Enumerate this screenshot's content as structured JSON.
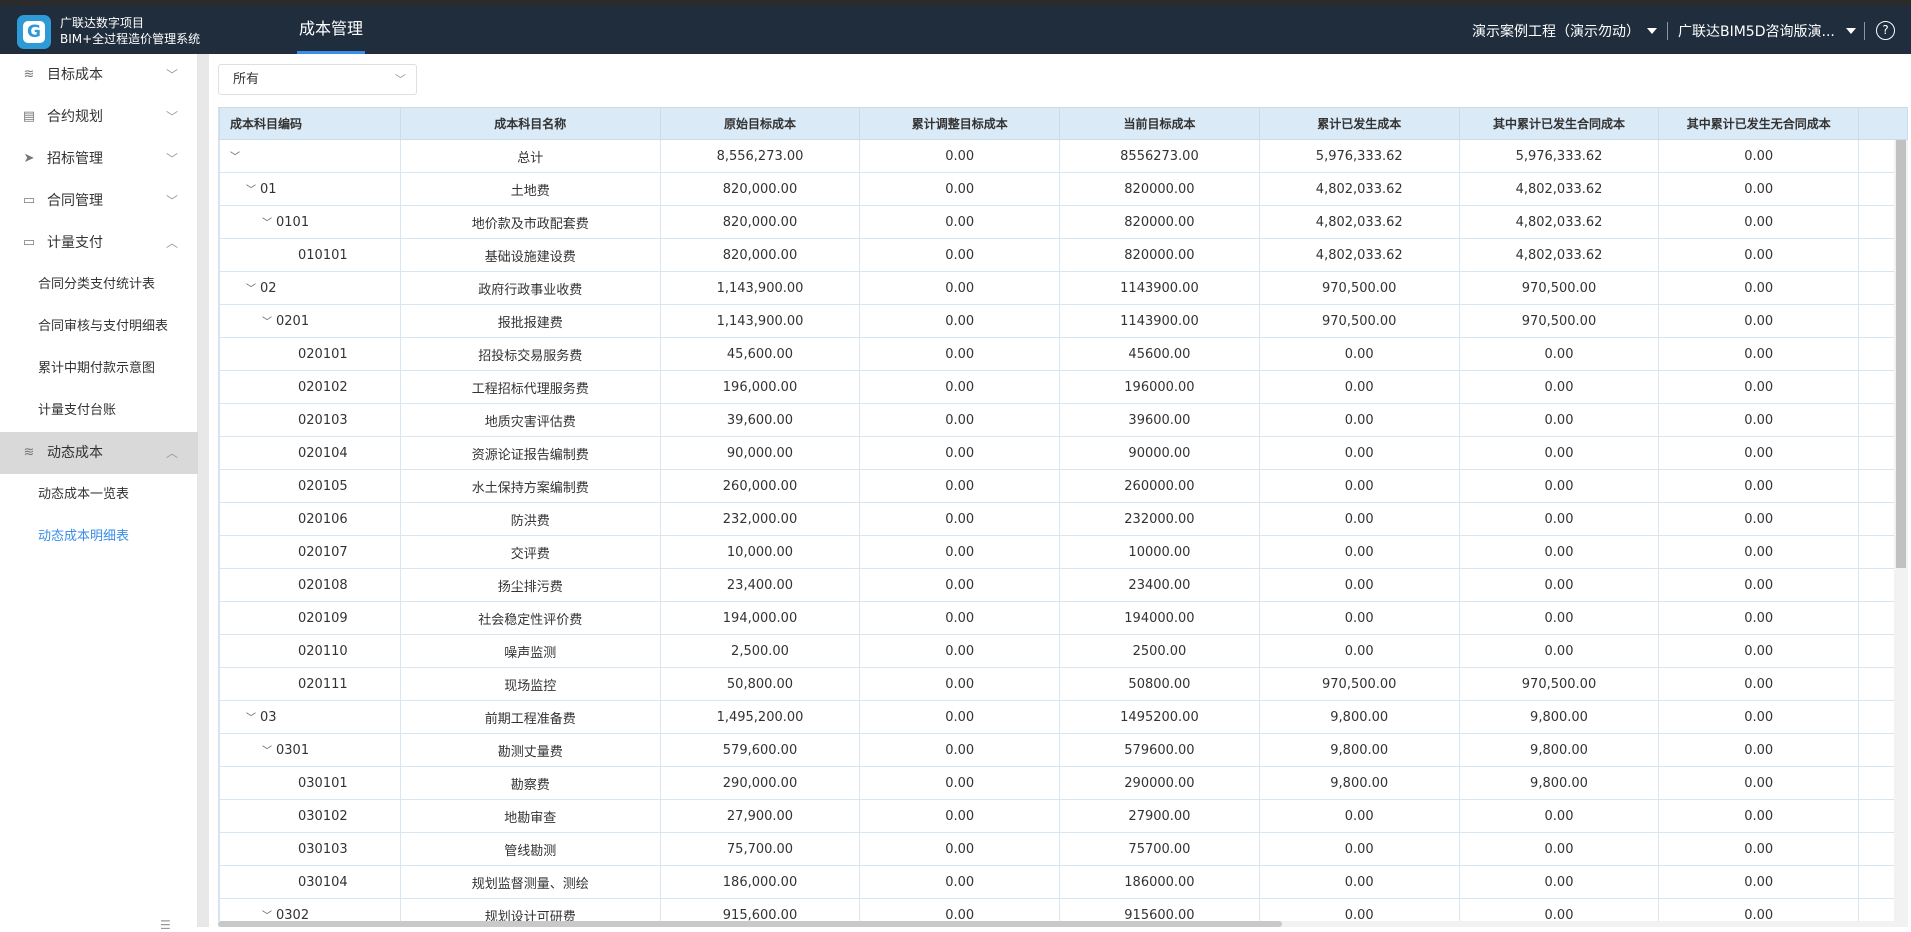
{
  "app": {
    "logo_letter": "G",
    "brand_line1": "广联达数字项目",
    "brand_line2": "BIM+全过程造价管理系统",
    "nav_tab": "成本管理",
    "project": "演示案例工程（演示勿动）",
    "org": "广联达BIM5D咨询版演...",
    "help": "?",
    "accent": "#3a8ee6",
    "header_bg": "#1f2d3d"
  },
  "sidebar": {
    "menus": [
      {
        "label": "目标成本",
        "icon": "coins-icon",
        "open": false
      },
      {
        "label": "合约规划",
        "icon": "document-icon",
        "open": false
      },
      {
        "label": "招标管理",
        "icon": "send-icon",
        "open": false
      },
      {
        "label": "合同管理",
        "icon": "briefcase-icon",
        "open": false
      },
      {
        "label": "计量支付",
        "icon": "briefcase-icon",
        "open": true
      },
      {
        "label": "动态成本",
        "icon": "coins-icon",
        "open": true
      }
    ],
    "payment_subs": [
      "合同分类支付统计表",
      "合同审核与支付明细表",
      "累计中期付款示意图",
      "计量支付台账"
    ],
    "dynamic_subs": [
      "动态成本一览表",
      "动态成本明细表"
    ]
  },
  "filter": {
    "value": "所有"
  },
  "table": {
    "columns": [
      "成本科目编码",
      "成本科目名称",
      "原始目标成本",
      "累计调整目标成本",
      "当前目标成本",
      "累计已发生成本",
      "其中累计已发生合同成本",
      "其中累计已发生无合同成本"
    ],
    "rows": [
      {
        "code": "",
        "name": "总计",
        "orig": "8,556,273.00",
        "adj": "0.00",
        "cur": "8556273.00",
        "occ": "5,976,333.62",
        "contract": "5,976,333.62",
        "noncontract": "0.00"
      },
      {
        "code": "01",
        "name": "土地费",
        "orig": "820,000.00",
        "adj": "0.00",
        "cur": "820000.00",
        "occ": "4,802,033.62",
        "contract": "4,802,033.62",
        "noncontract": "0.00"
      },
      {
        "code": "0101",
        "name": "地价款及市政配套费",
        "orig": "820,000.00",
        "adj": "0.00",
        "cur": "820000.00",
        "occ": "4,802,033.62",
        "contract": "4,802,033.62",
        "noncontract": "0.00"
      },
      {
        "code": "010101",
        "name": "基础设施建设费",
        "orig": "820,000.00",
        "adj": "0.00",
        "cur": "820000.00",
        "occ": "4,802,033.62",
        "contract": "4,802,033.62",
        "noncontract": "0.00"
      },
      {
        "code": "02",
        "name": "政府行政事业收费",
        "orig": "1,143,900.00",
        "adj": "0.00",
        "cur": "1143900.00",
        "occ": "970,500.00",
        "contract": "970,500.00",
        "noncontract": "0.00"
      },
      {
        "code": "0201",
        "name": "报批报建费",
        "orig": "1,143,900.00",
        "adj": "0.00",
        "cur": "1143900.00",
        "occ": "970,500.00",
        "contract": "970,500.00",
        "noncontract": "0.00"
      },
      {
        "code": "020101",
        "name": "招投标交易服务费",
        "orig": "45,600.00",
        "adj": "0.00",
        "cur": "45600.00",
        "occ": "0.00",
        "contract": "0.00",
        "noncontract": "0.00"
      },
      {
        "code": "020102",
        "name": "工程招标代理服务费",
        "orig": "196,000.00",
        "adj": "0.00",
        "cur": "196000.00",
        "occ": "0.00",
        "contract": "0.00",
        "noncontract": "0.00"
      },
      {
        "code": "020103",
        "name": "地质灾害评估费",
        "orig": "39,600.00",
        "adj": "0.00",
        "cur": "39600.00",
        "occ": "0.00",
        "contract": "0.00",
        "noncontract": "0.00"
      },
      {
        "code": "020104",
        "name": "资源论证报告编制费",
        "orig": "90,000.00",
        "adj": "0.00",
        "cur": "90000.00",
        "occ": "0.00",
        "contract": "0.00",
        "noncontract": "0.00"
      },
      {
        "code": "020105",
        "name": "水土保持方案编制费",
        "orig": "260,000.00",
        "adj": "0.00",
        "cur": "260000.00",
        "occ": "0.00",
        "contract": "0.00",
        "noncontract": "0.00"
      },
      {
        "code": "020106",
        "name": "防洪费",
        "orig": "232,000.00",
        "adj": "0.00",
        "cur": "232000.00",
        "occ": "0.00",
        "contract": "0.00",
        "noncontract": "0.00"
      },
      {
        "code": "020107",
        "name": "交评费",
        "orig": "10,000.00",
        "adj": "0.00",
        "cur": "10000.00",
        "occ": "0.00",
        "contract": "0.00",
        "noncontract": "0.00"
      },
      {
        "code": "020108",
        "name": "扬尘排污费",
        "orig": "23,400.00",
        "adj": "0.00",
        "cur": "23400.00",
        "occ": "0.00",
        "contract": "0.00",
        "noncontract": "0.00"
      },
      {
        "code": "020109",
        "name": "社会稳定性评价费",
        "orig": "194,000.00",
        "adj": "0.00",
        "cur": "194000.00",
        "occ": "0.00",
        "contract": "0.00",
        "noncontract": "0.00"
      },
      {
        "code": "020110",
        "name": "噪声监测",
        "orig": "2,500.00",
        "adj": "0.00",
        "cur": "2500.00",
        "occ": "0.00",
        "contract": "0.00",
        "noncontract": "0.00"
      },
      {
        "code": "020111",
        "name": "现场监控",
        "orig": "50,800.00",
        "adj": "0.00",
        "cur": "50800.00",
        "occ": "970,500.00",
        "contract": "970,500.00",
        "noncontract": "0.00"
      },
      {
        "code": "03",
        "name": "前期工程准备费",
        "orig": "1,495,200.00",
        "adj": "0.00",
        "cur": "1495200.00",
        "occ": "9,800.00",
        "contract": "9,800.00",
        "noncontract": "0.00"
      },
      {
        "code": "0301",
        "name": "勘测丈量费",
        "orig": "579,600.00",
        "adj": "0.00",
        "cur": "579600.00",
        "occ": "9,800.00",
        "contract": "9,800.00",
        "noncontract": "0.00"
      },
      {
        "code": "030101",
        "name": "勘察费",
        "orig": "290,000.00",
        "adj": "0.00",
        "cur": "290000.00",
        "occ": "9,800.00",
        "contract": "9,800.00",
        "noncontract": "0.00"
      },
      {
        "code": "030102",
        "name": "地勘审查",
        "orig": "27,900.00",
        "adj": "0.00",
        "cur": "27900.00",
        "occ": "0.00",
        "contract": "0.00",
        "noncontract": "0.00"
      },
      {
        "code": "030103",
        "name": "管线勘测",
        "orig": "75,700.00",
        "adj": "0.00",
        "cur": "75700.00",
        "occ": "0.00",
        "contract": "0.00",
        "noncontract": "0.00"
      },
      {
        "code": "030104",
        "name": "规划监督测量、测绘",
        "orig": "186,000.00",
        "adj": "0.00",
        "cur": "186000.00",
        "occ": "0.00",
        "contract": "0.00",
        "noncontract": "0.00"
      },
      {
        "code": "0302",
        "name": "规划设计可研费",
        "orig": "915,600.00",
        "adj": "0.00",
        "cur": "915600.00",
        "occ": "0.00",
        "contract": "0.00",
        "noncontract": "0.00"
      }
    ]
  }
}
